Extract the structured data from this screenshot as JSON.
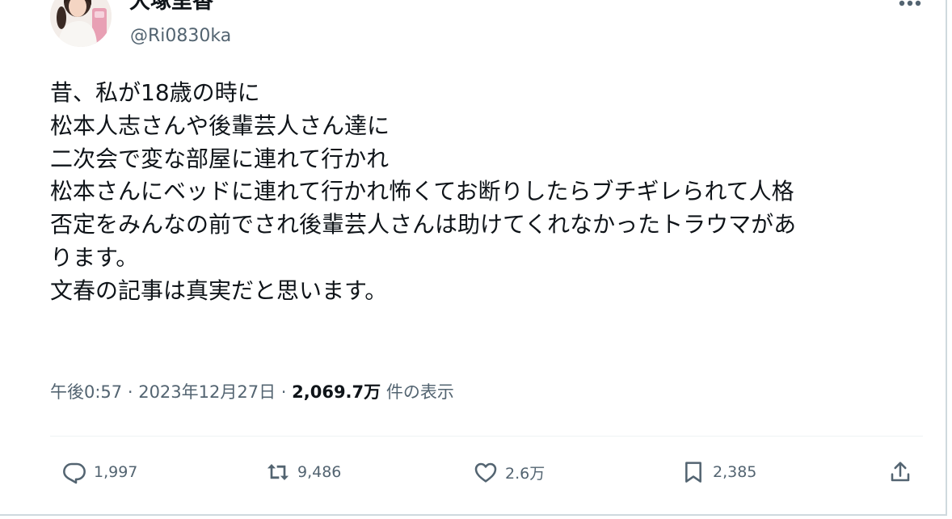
{
  "author": {
    "display_name": "大塚里香",
    "handle": "@Ri0830ka"
  },
  "tweet": {
    "lines": [
      "昔、私が18歳の時に",
      "松本人志さんや後輩芸人さん達に",
      "二次会で変な部屋に連れて行かれ",
      "松本さんにベッドに連れて行かれ怖くてお断りしたらブチギレられて人格",
      "否定をみんなの前でされ後輩芸人さんは助けてくれなかったトラウマがあ",
      "ります。",
      "文春の記事は真実だと思います。"
    ]
  },
  "meta": {
    "time": "午後0:57",
    "separator": " · ",
    "date": "2023年12月27日",
    "views_count": "2,069.7万",
    "views_label": " 件の表示"
  },
  "actions": {
    "reply_count": "1,997",
    "retweet_count": "9,486",
    "like_count": "2.6万",
    "bookmark_count": "2,385"
  },
  "icons": {
    "more": "more-dots-icon",
    "reply": "reply-bubble-icon",
    "retweet": "retweet-arrows-icon",
    "like": "heart-icon",
    "bookmark": "bookmark-icon",
    "share": "share-upload-icon"
  },
  "colors": {
    "text_primary": "#0f1419",
    "text_secondary": "#536471",
    "divider": "#eff3f4",
    "frame": "#cfd9de"
  }
}
